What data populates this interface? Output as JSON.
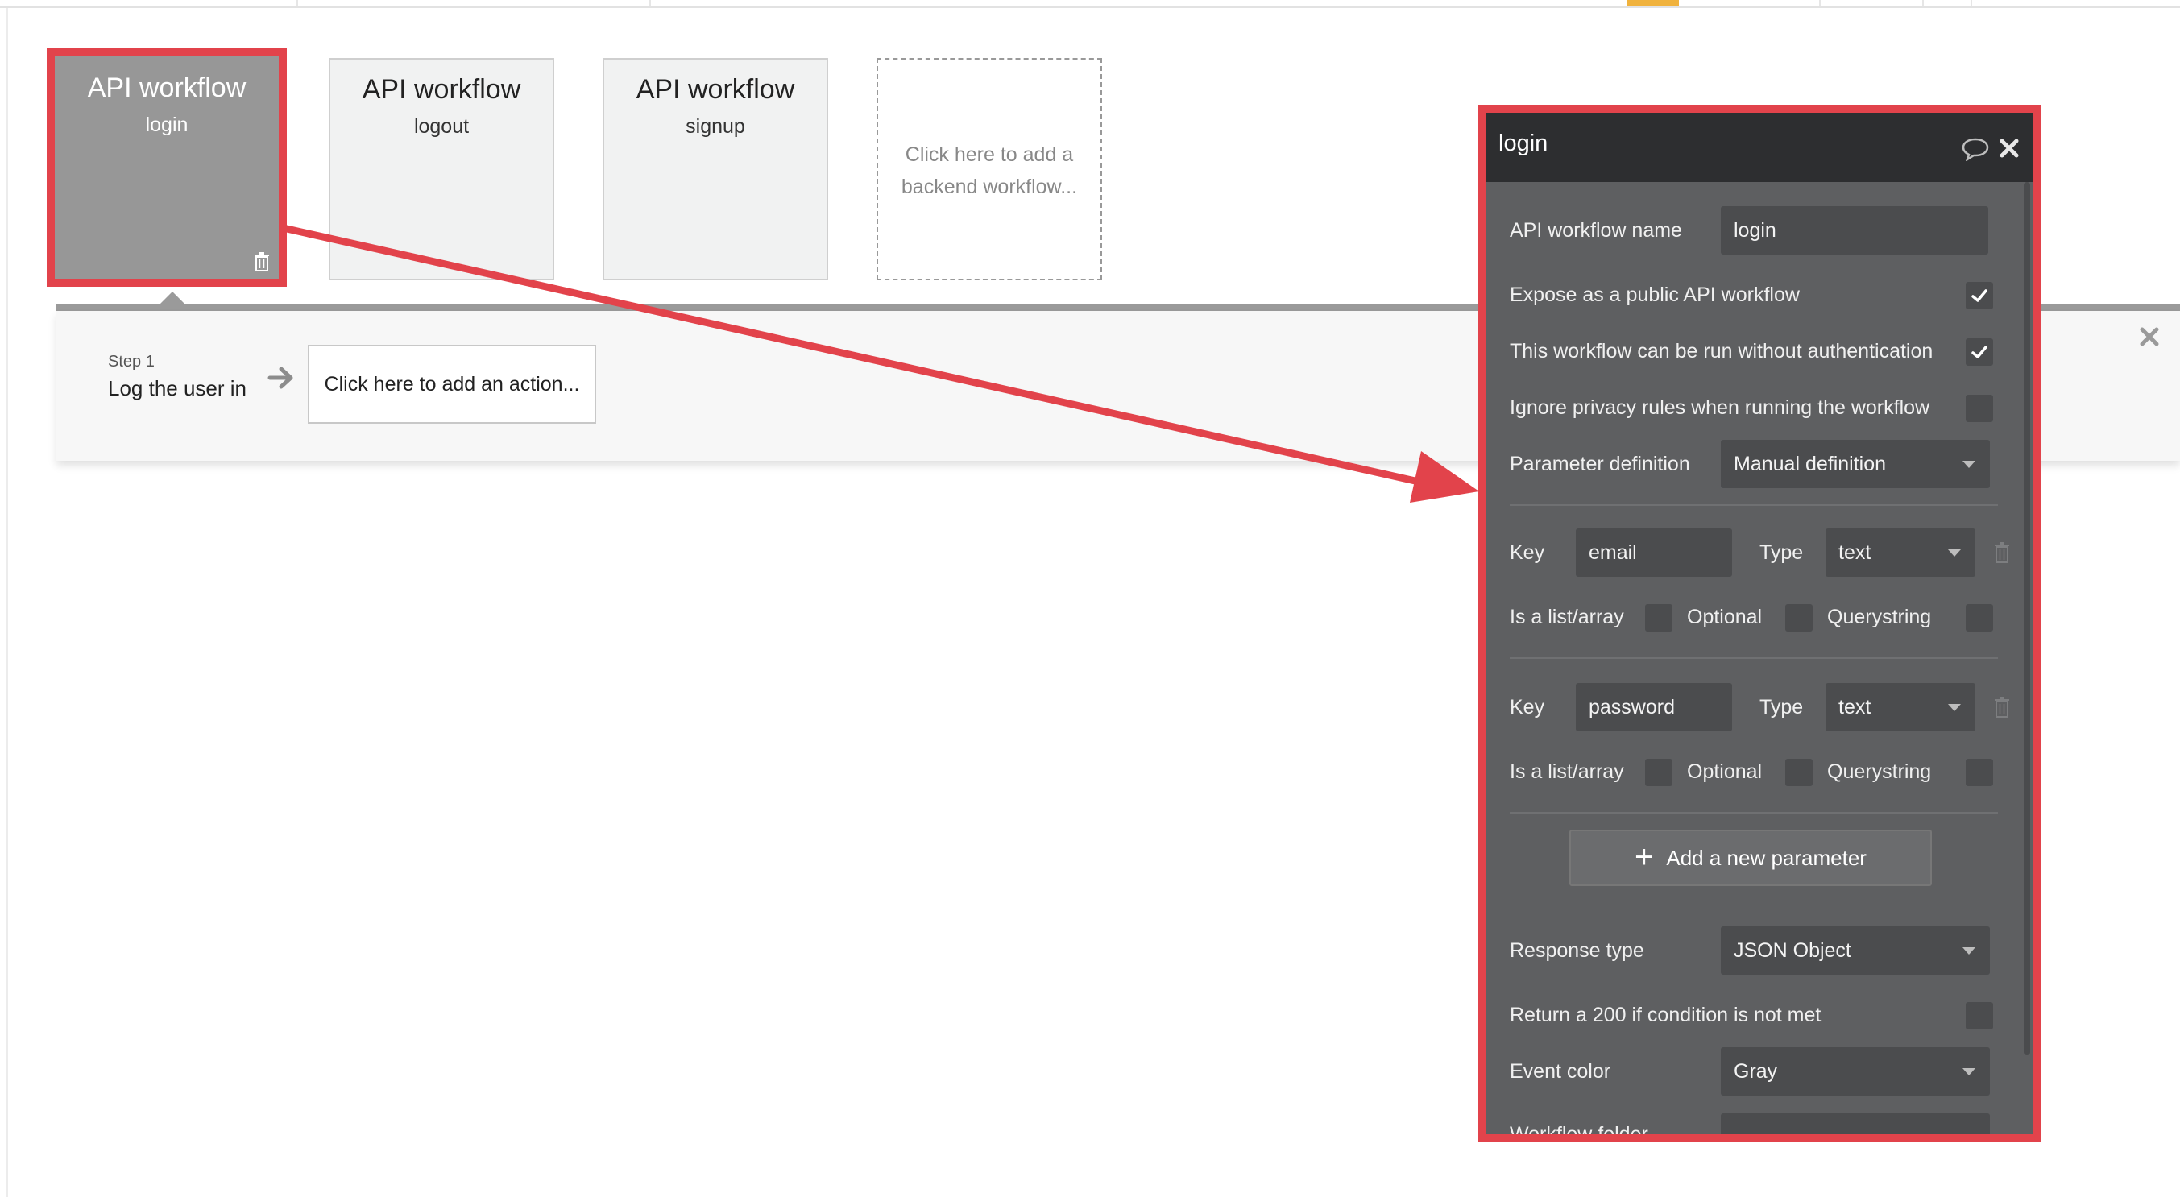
{
  "workflows": [
    {
      "title": "API workflow",
      "name": "login"
    },
    {
      "title": "API workflow",
      "name": "logout"
    },
    {
      "title": "API workflow",
      "name": "signup"
    }
  ],
  "add_workflow_text": "Click here to add a backend workflow...",
  "steps": {
    "step_label": "Step 1",
    "step_name": "Log the user in",
    "add_action_text": "Click here to add an action..."
  },
  "editor": {
    "title": "login",
    "api_workflow_name_label": "API workflow name",
    "api_workflow_name_value": "login",
    "expose_public_label": "Expose as a public API workflow",
    "expose_public_checked": true,
    "no_auth_label": "This workflow can be run without authentication",
    "no_auth_checked": true,
    "ignore_privacy_label": "Ignore privacy rules when running the workflow",
    "ignore_privacy_checked": false,
    "parameter_definition_label": "Parameter definition",
    "parameter_definition_value": "Manual definition",
    "parameters": [
      {
        "key_label": "Key",
        "key": "email",
        "type_label": "Type",
        "type": "text",
        "list_label": "Is a list/array",
        "optional_label": "Optional",
        "querystring_label": "Querystring"
      },
      {
        "key_label": "Key",
        "key": "password",
        "type_label": "Type",
        "type": "text",
        "list_label": "Is a list/array",
        "optional_label": "Optional",
        "querystring_label": "Querystring"
      }
    ],
    "add_parameter_label": "Add a new parameter",
    "response_type_label": "Response type",
    "response_type_value": "JSON Object",
    "return_200_label": "Return a 200 if condition is not met",
    "return_200_checked": false,
    "event_color_label": "Event color",
    "event_color_value": "Gray",
    "workflow_folder_label": "Workflow folder",
    "workflow_folder_value": ""
  },
  "colors": {
    "highlight_red": "#e2434b",
    "accent_orange": "#f0b23d",
    "editor_bg": "#5e5f61",
    "editor_header": "#2d2e30",
    "selected_card": "#979797"
  },
  "icons": {
    "card_delete": "trash-icon",
    "step_arrow": "arrow-right-icon",
    "close": "close-icon",
    "comment": "comment-icon",
    "checkbox_checked": "checkmark-icon",
    "add": "plus-icon",
    "dropdown": "chevron-down-icon"
  }
}
